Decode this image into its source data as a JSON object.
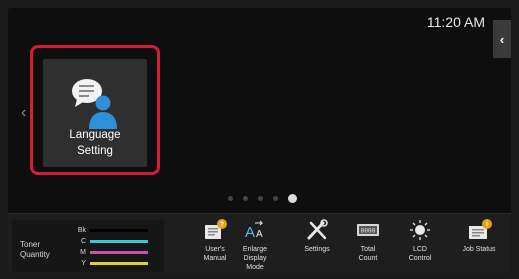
{
  "status": {
    "time": "11:20 AM"
  },
  "home": {
    "tile": {
      "label_line1": "Language",
      "label_line2": "Setting",
      "highlight_color": "#d01f38"
    },
    "page_count": 5,
    "active_page": 5
  },
  "toner": {
    "title_line1": "Toner",
    "title_line2": "Quantity",
    "rows": [
      {
        "label": "Bk",
        "color": "#000000"
      },
      {
        "label": "C",
        "color": "#38c7d8"
      },
      {
        "label": "M",
        "color": "#c94fb0"
      },
      {
        "label": "Y",
        "color": "#d8d33a"
      }
    ]
  },
  "dock": {
    "users_manual": {
      "line1": "User's",
      "line2": "Manual"
    },
    "enlarge_display": {
      "line1": "Enlarge",
      "line2": "Display",
      "line3": "Mode"
    },
    "settings": {
      "line1": "Settings"
    },
    "total_count": {
      "line1": "Total",
      "line2": "Count"
    },
    "lcd_control": {
      "line1": "LCD",
      "line2": "Control"
    },
    "job_status": {
      "line1": "Job Status"
    }
  }
}
